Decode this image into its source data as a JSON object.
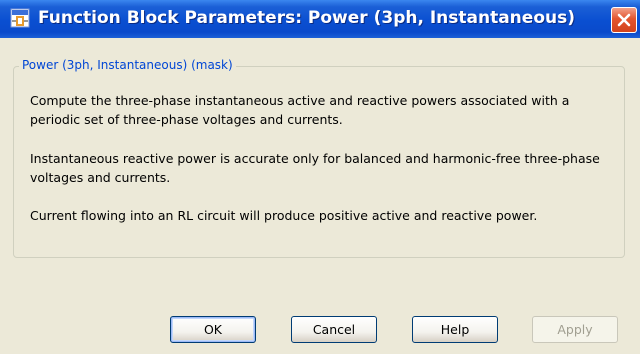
{
  "window": {
    "title": "Function Block Parameters: Power (3ph, Instantaneous)"
  },
  "group": {
    "legend": "Power (3ph, Instantaneous) (mask)",
    "paragraphs": [
      "Compute the three-phase instantaneous active and reactive powers associated with a periodic set of three-phase voltages and currents.",
      "Instantaneous reactive power is accurate only for balanced and harmonic-free three-phase voltages and currents.",
      "Current flowing into an RL circuit will produce positive active and reactive power."
    ]
  },
  "buttons": {
    "ok": "OK",
    "cancel": "Cancel",
    "help": "Help",
    "apply": "Apply"
  },
  "icons": {
    "title": "simulink-block-icon",
    "close": "close-icon"
  },
  "colors": {
    "titlebar": "#0a4fd1",
    "dialog_bg": "#ECE9D8",
    "legend_text": "#0046d5",
    "close_button": "#e3552f",
    "disabled_text": "#a19f91"
  }
}
